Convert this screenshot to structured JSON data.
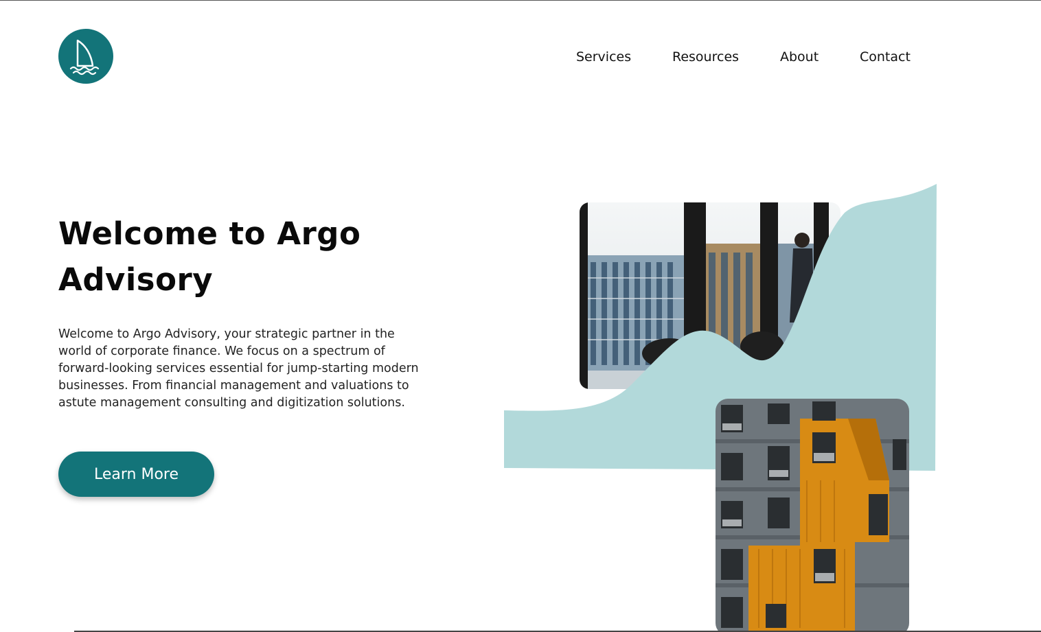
{
  "nav": {
    "items": [
      {
        "label": "Services"
      },
      {
        "label": "Resources"
      },
      {
        "label": "About"
      },
      {
        "label": "Contact"
      }
    ]
  },
  "hero": {
    "title": "Welcome to Argo Advisory",
    "body": "Welcome to Argo Advisory, your strategic partner in the world of corporate finance. We focus on a spectrum of forward-looking services essential for jump-starting modern businesses. From financial management and valuations to astute management consulting and digitization solutions.",
    "cta_label": "Learn More"
  },
  "colors": {
    "brand": "#137479",
    "wave": "#b2d9da",
    "text": "#111111",
    "background": "#ffffff"
  },
  "icons": {
    "logo": "sailboat-icon"
  }
}
